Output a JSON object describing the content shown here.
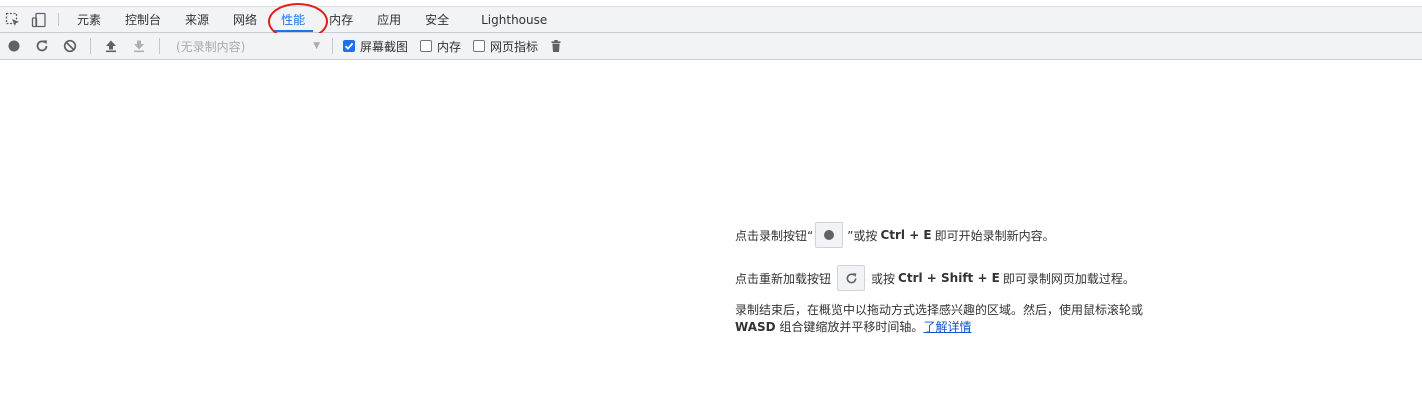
{
  "tabbar": {
    "icons": [
      "inspect-element-icon",
      "device-toolbar-icon"
    ],
    "tabs": [
      {
        "label": "元素",
        "active": false
      },
      {
        "label": "控制台",
        "active": false
      },
      {
        "label": "来源",
        "active": false
      },
      {
        "label": "网络",
        "active": false
      },
      {
        "label": "性能",
        "active": true
      },
      {
        "label": "内存",
        "active": false
      },
      {
        "label": "应用",
        "active": false
      },
      {
        "label": "安全",
        "active": false
      },
      {
        "label": "Lighthouse",
        "active": false
      }
    ]
  },
  "toolbar": {
    "icons": [
      "record-icon",
      "reload-record-icon",
      "clear-icon",
      "upload-profile-icon",
      "download-profile-icon"
    ],
    "recording_select": "(无录制内容)",
    "checkboxes": [
      {
        "label": "屏幕截图",
        "checked": true
      },
      {
        "label": "内存",
        "checked": false
      },
      {
        "label": "网页指标",
        "checked": false
      }
    ],
    "trash_icon": "trash-icon"
  },
  "landing": {
    "line1": {
      "before": "点击录制按钮“",
      "after_button": "”或按",
      "shortcut": "Ctrl + E",
      "end": "即可开始录制新内容。"
    },
    "line2": {
      "before": "点击重新加载按钮",
      "after_button": "或按",
      "shortcut": "Ctrl + Shift + E",
      "end": "即可录制网页加载过程。"
    },
    "para": {
      "line1": "录制结束后，在概览中以拖动方式选择感兴趣的区域。然后，使用鼠标滚轮或",
      "bold": "WASD",
      "line2": "组合键缩放并平移时间轴。",
      "link": "了解详情"
    }
  },
  "colors": {
    "accent": "#1a73e8",
    "highlight_circle": "#e0201b",
    "toolbar_bg": "#f1f3f4"
  }
}
